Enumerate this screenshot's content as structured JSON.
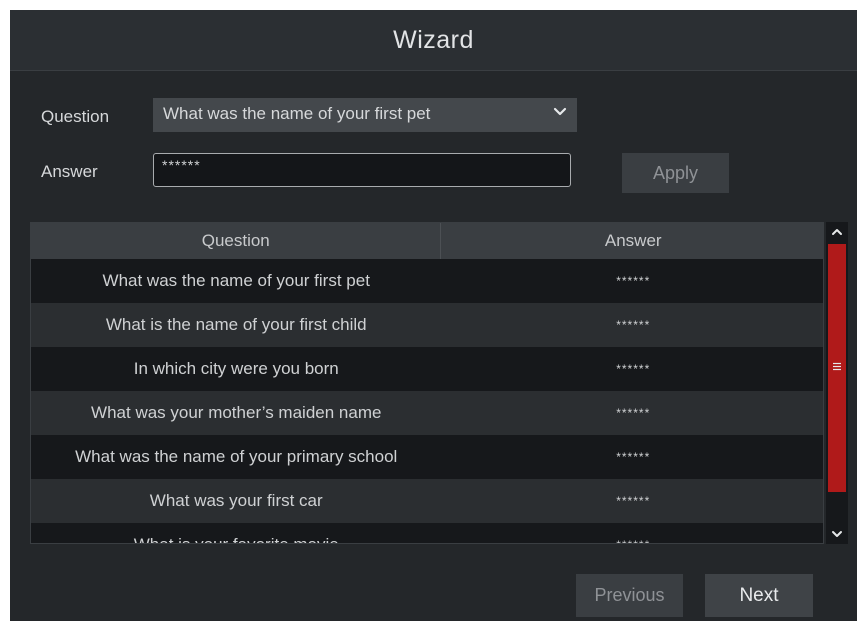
{
  "window": {
    "title": "Wizard"
  },
  "form": {
    "question_label": "Question",
    "question_selected": "What was the name of your first pet",
    "answer_label": "Answer",
    "answer_value": "******",
    "apply_label": "Apply"
  },
  "table": {
    "headers": {
      "question": "Question",
      "answer": "Answer"
    },
    "rows": [
      {
        "question": "What was the name of your first pet",
        "answer": "******"
      },
      {
        "question": "What is the name of your first child",
        "answer": "******"
      },
      {
        "question": "In which city were you born",
        "answer": "******"
      },
      {
        "question": "What was your mother’s maiden name",
        "answer": "******"
      },
      {
        "question": "What was the name of your primary school",
        "answer": "******"
      },
      {
        "question": "What was your first car",
        "answer": "******"
      },
      {
        "question": "What is your favorite movie",
        "answer": "******"
      }
    ]
  },
  "footer": {
    "previous_label": "Previous",
    "next_label": "Next"
  },
  "icons": {
    "dropdown": "chevron-down-icon",
    "scroll_up": "chevron-up-icon",
    "scroll_down": "chevron-down-icon",
    "scroll_grip": "grip-lines-icon"
  },
  "colors": {
    "background": "#24272a",
    "title_bar": "#2b2f33",
    "scroll_thumb": "#b01a1a"
  }
}
